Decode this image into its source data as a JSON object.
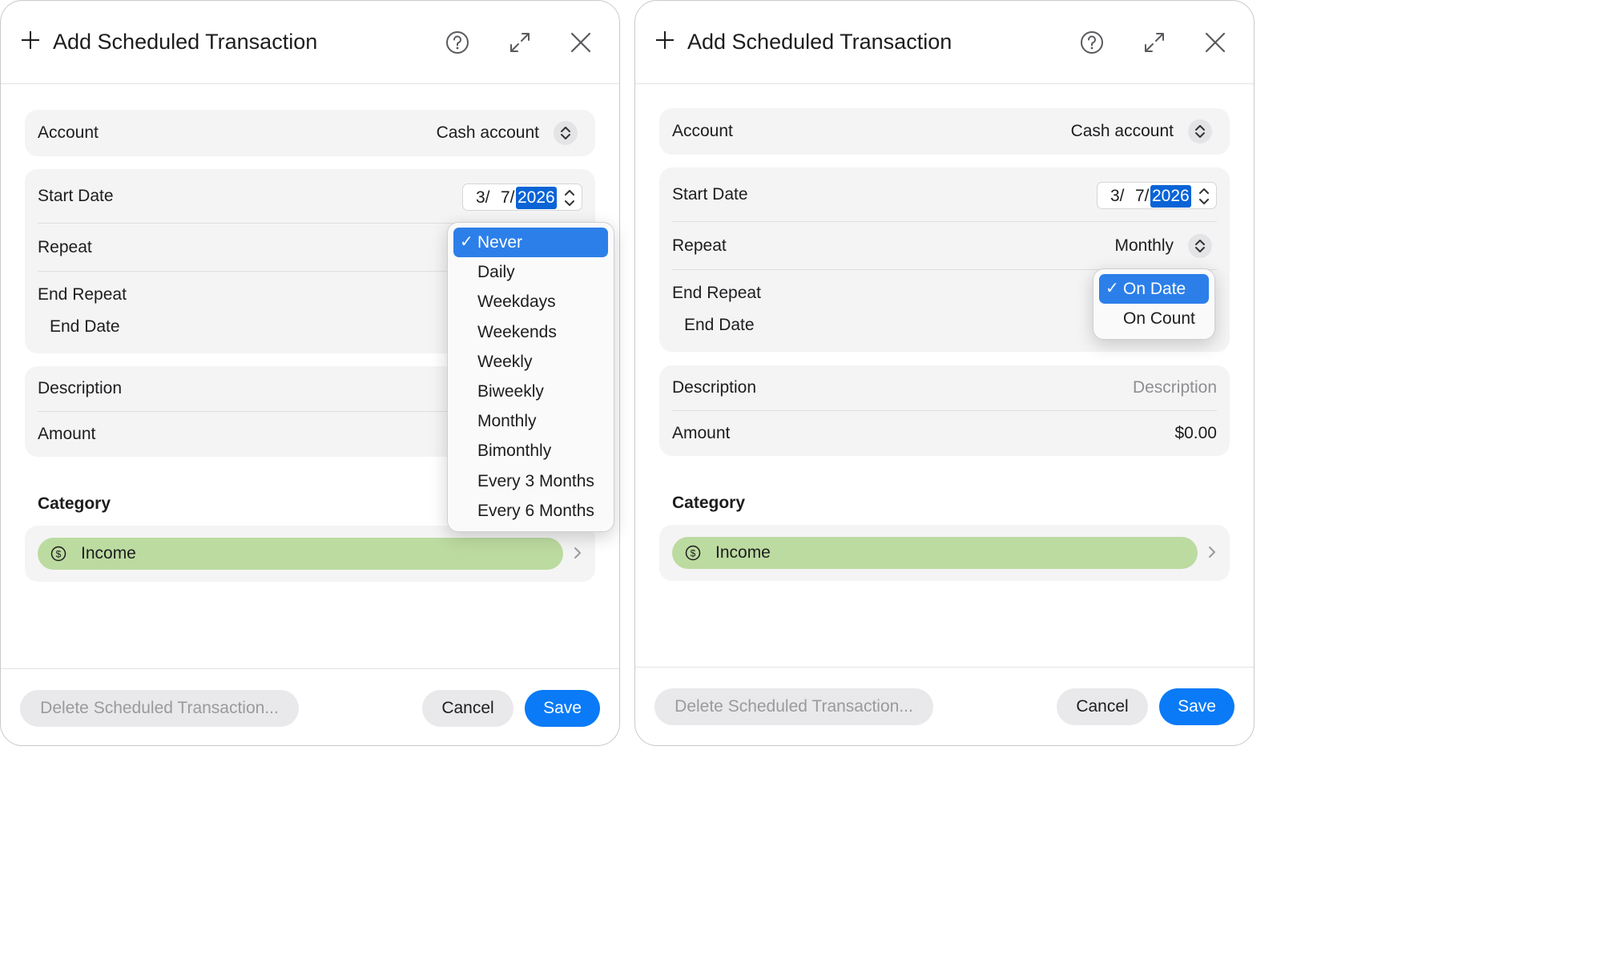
{
  "left": {
    "title": "Add Scheduled Transaction",
    "account": {
      "label": "Account",
      "value": "Cash account"
    },
    "start_date": {
      "label": "Start Date",
      "month": "3/",
      "day": "7/",
      "year": "2026"
    },
    "repeat": {
      "label": "Repeat"
    },
    "end_repeat": {
      "label": "End Repeat"
    },
    "end_date": {
      "label": "End Date"
    },
    "description": {
      "label": "Description"
    },
    "amount": {
      "label": "Amount"
    },
    "category_label": "Category",
    "category": "Income",
    "repeat_menu": {
      "selected_index": 0,
      "check": "✓",
      "items": [
        "Never",
        "Daily",
        "Weekdays",
        "Weekends",
        "Weekly",
        "Biweekly",
        "Monthly",
        "Bimonthly",
        "Every 3 Months",
        "Every 6 Months"
      ]
    },
    "buttons": {
      "delete": "Delete Scheduled Transaction...",
      "cancel": "Cancel",
      "save": "Save"
    }
  },
  "right": {
    "title": "Add Scheduled Transaction",
    "account": {
      "label": "Account",
      "value": "Cash account"
    },
    "start_date": {
      "label": "Start Date",
      "month": "3/",
      "day": "7/",
      "year": "2026"
    },
    "repeat": {
      "label": "Repeat",
      "value": "Monthly"
    },
    "end_repeat": {
      "label": "End Repeat"
    },
    "end_date": {
      "label": "End Date"
    },
    "description": {
      "label": "Description",
      "placeholder": "Description"
    },
    "amount": {
      "label": "Amount",
      "value": "$0.00"
    },
    "category_label": "Category",
    "category": "Income",
    "end_repeat_menu": {
      "selected_index": 0,
      "check": "✓",
      "items": [
        "On Date",
        "On Count"
      ]
    },
    "buttons": {
      "delete": "Delete Scheduled Transaction...",
      "cancel": "Cancel",
      "save": "Save"
    }
  },
  "colors": {
    "accent": "#0a7af6",
    "menu_selection": "#2c7fe9",
    "category_pill": "#bcdba0",
    "card_bg": "#f4f4f5"
  },
  "icons": [
    "plus-icon",
    "help-icon",
    "expand-icon",
    "close-icon",
    "stepper-icon",
    "coin-icon",
    "chevron-right-icon",
    "checkmark-icon"
  ]
}
